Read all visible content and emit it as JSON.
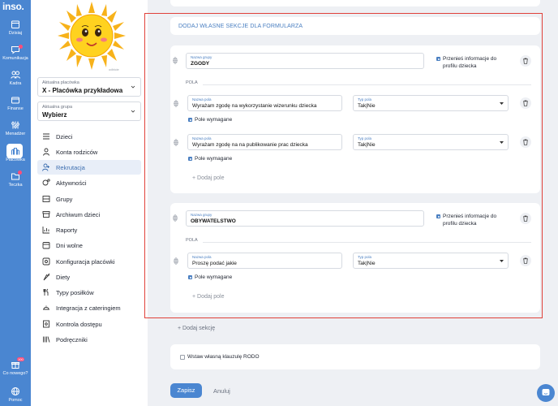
{
  "rail": {
    "logo": "inso.",
    "items": [
      {
        "label": "Dzisiaj",
        "icon": "calendar-icon"
      },
      {
        "label": "Komunikacja",
        "icon": "chat-icon"
      },
      {
        "label": "Kadra",
        "icon": "people-icon"
      },
      {
        "label": "Finanse",
        "icon": "wallet-icon"
      },
      {
        "label": "Menadżer",
        "icon": "sliders-icon"
      },
      {
        "label": "Placówka",
        "icon": "building-icon"
      },
      {
        "label": "Teczka",
        "icon": "folder-icon"
      }
    ],
    "bottom": [
      {
        "label": "Co nowego?",
        "icon": "gift-icon",
        "badge": "100"
      },
      {
        "label": "Pomoc",
        "icon": "globe-icon"
      }
    ]
  },
  "sidebar": {
    "photo_caption": "odbicie",
    "facility": {
      "label": "Aktualna placówka",
      "value": "X - Placówka przykładowa"
    },
    "group": {
      "label": "Aktualna grupa",
      "value": "Wybierz"
    },
    "menu": [
      {
        "label": "Dzieci",
        "icon": "list-icon"
      },
      {
        "label": "Konta rodziców",
        "icon": "user-icon"
      },
      {
        "label": "Rekrutacja",
        "icon": "user-plus-icon",
        "active": true
      },
      {
        "label": "Aktywności",
        "icon": "activity-icon"
      },
      {
        "label": "Grupy",
        "icon": "grid-icon"
      },
      {
        "label": "Archiwum dzieci",
        "icon": "archive-icon"
      },
      {
        "label": "Raporty",
        "icon": "chart-icon"
      },
      {
        "label": "Dni wolne",
        "icon": "calendar-icon"
      },
      {
        "label": "Konfiguracja placówki",
        "icon": "settings-icon"
      },
      {
        "label": "Diety",
        "icon": "carrot-icon"
      },
      {
        "label": "Typy posiłków",
        "icon": "meal-icon"
      },
      {
        "label": "Integracja z cateringiem",
        "icon": "catering-icon"
      },
      {
        "label": "Kontrola dostępu",
        "icon": "lock-icon"
      },
      {
        "label": "Podręczniki",
        "icon": "book-icon"
      }
    ]
  },
  "form": {
    "section_title": "DODAJ WŁASNE SEKCJE DLA FORMULARZA",
    "groups": [
      {
        "group_label": "Nazwa grupy",
        "group_value": "ZGODY",
        "transfer_label": "Przenieś informacje do profilu dziecka",
        "fields_heading": "POLA",
        "fields": [
          {
            "name_label": "Nazwa pola",
            "name_value": "Wyrażam zgodę na wykorzystanie wizerunku dziecka",
            "type_label": "Typ pola",
            "type_value": "Tak|Nie",
            "required_label": "Pole wymagane"
          },
          {
            "name_label": "Nazwa pola",
            "name_value": "Wyrażam zgodę na na publikowanie prac dziecka",
            "type_label": "Typ pola",
            "type_value": "Tak|Nie",
            "required_label": "Pole wymagane"
          }
        ],
        "add_field": "+ Dodaj pole"
      },
      {
        "group_label": "Nazwa grupy",
        "group_value": "OBYWATELSTWO",
        "transfer_label": "Przenieś informacje do profilu dziecka",
        "fields_heading": "POLA",
        "fields": [
          {
            "name_label": "Nazwa pola",
            "name_value": "Proszę podać jakie",
            "type_label": "Typ pola",
            "type_value": "Tak|Nie",
            "required_label": "Pole wymagane"
          }
        ],
        "add_field": "+ Dodaj pole"
      }
    ],
    "add_section": "+ Dodaj sekcję",
    "rodo_label": "Wstaw własną klauzulę RODO",
    "save": "Zapisz",
    "cancel": "Anuluj"
  },
  "colors": {
    "accent": "#4a86d1",
    "highlight": "#e0413a",
    "active_bg": "#e8eef8"
  }
}
